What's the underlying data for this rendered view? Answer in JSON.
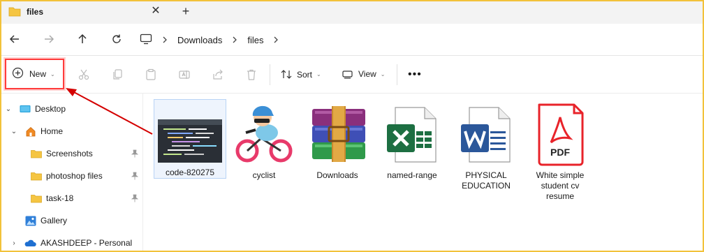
{
  "window": {
    "tab_title": "files",
    "close_glyph": "✕",
    "newtab_glyph": "+"
  },
  "nav": {
    "back_icon": "arrow-left-icon",
    "forward_icon": "arrow-right-icon",
    "up_icon": "arrow-up-icon",
    "refresh_icon": "refresh-icon",
    "breadcrumbs": [
      "Downloads",
      "files"
    ]
  },
  "command_bar": {
    "new_label": "New",
    "sort_label": "Sort",
    "view_label": "View",
    "more_label": "•••",
    "dropdown_glyph": "⌄"
  },
  "sidebar": {
    "items": [
      {
        "label": "Desktop",
        "icon": "desktop-icon",
        "expander": "⌄"
      },
      {
        "label": "Home",
        "icon": "home-icon",
        "expander": "⌄"
      },
      {
        "label": "Screenshots",
        "icon": "folder-icon",
        "pinned": true
      },
      {
        "label": "photoshop files",
        "icon": "folder-icon",
        "pinned": true
      },
      {
        "label": "task-18",
        "icon": "folder-icon",
        "pinned": true
      },
      {
        "label": "Gallery",
        "icon": "gallery-icon"
      },
      {
        "label": "AKASHDEEP - Personal",
        "icon": "onedrive-cloud-icon",
        "expander": "›"
      }
    ]
  },
  "files": [
    {
      "name": "code-820275",
      "type": "image",
      "selected": true
    },
    {
      "name": "cyclist",
      "type": "image"
    },
    {
      "name": "Downloads",
      "type": "winrar-archive"
    },
    {
      "name": "named-range",
      "type": "excel-document"
    },
    {
      "name": "PHYSICAL EDUCATION",
      "type": "word-document"
    },
    {
      "name": "White simple student cv resume",
      "type": "pdf-document",
      "badge": "PDF"
    }
  ],
  "colors": {
    "frame_border": "#f2c23a",
    "highlight_red": "#ff3b3b",
    "arrow_red": "#d40000",
    "folder_yellow": "#f5c542",
    "excel_green": "#1d6f42",
    "word_blue": "#2b579a",
    "pdf_red": "#e8232a",
    "selection_bg": "#eef4fd"
  }
}
